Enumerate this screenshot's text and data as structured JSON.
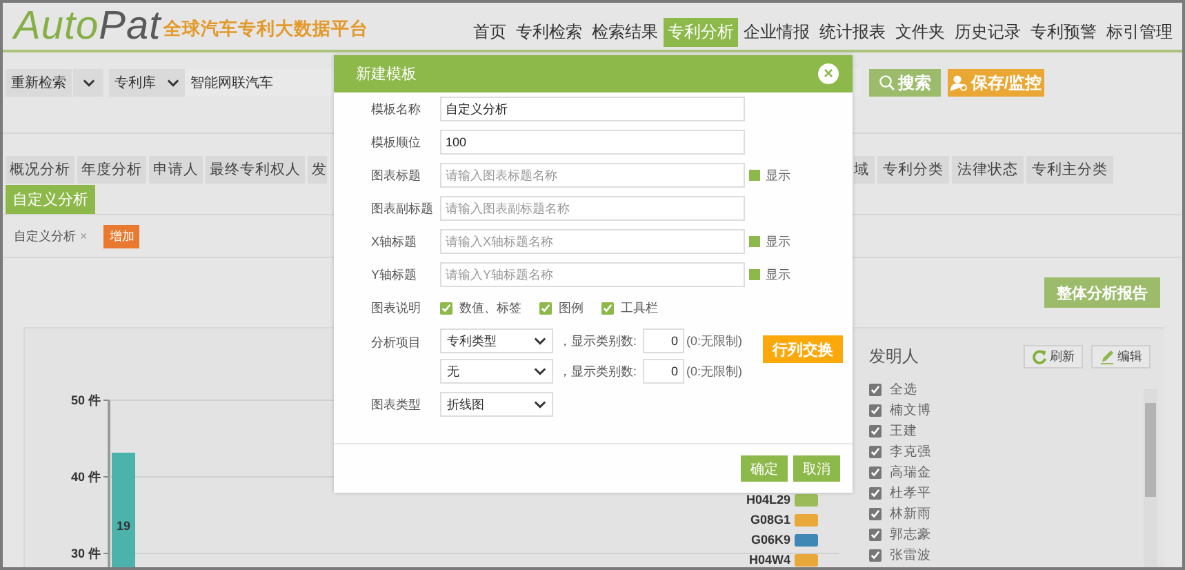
{
  "header": {
    "logo_lead": "Auto",
    "logo_tail": "Pat",
    "tagline": "全球汽车专利大数据平台",
    "nav": [
      {
        "label": "首页",
        "selected": false
      },
      {
        "label": "专利检索",
        "selected": false
      },
      {
        "label": "检索结果",
        "selected": false
      },
      {
        "label": "专利分析",
        "selected": true
      },
      {
        "label": "企业情报",
        "selected": false
      },
      {
        "label": "统计报表",
        "selected": false
      },
      {
        "label": "文件夹",
        "selected": false
      },
      {
        "label": "历史记录",
        "selected": false
      },
      {
        "label": "专利预警",
        "selected": false
      },
      {
        "label": "标引管理",
        "selected": false
      }
    ]
  },
  "search": {
    "mode": "重新检索",
    "database": "专利库",
    "query": "智能网联汽车",
    "search_button": "搜索",
    "save_button": "保存/监控"
  },
  "analysis_tabs_left": [
    {
      "label": "概况分析",
      "selected": false
    },
    {
      "label": "年度分析",
      "selected": false
    },
    {
      "label": "申请人",
      "selected": false
    },
    {
      "label": "最终专利权人",
      "selected": false
    },
    {
      "label": "发",
      "selected": false
    }
  ],
  "analysis_tabs_right": [
    {
      "label": "域",
      "selected": false
    },
    {
      "label": "专利分类",
      "selected": false
    },
    {
      "label": "法律状态",
      "selected": false
    },
    {
      "label": "专利主分类",
      "selected": false
    }
  ],
  "analysis_tabs_row_2": [
    {
      "label": "自定义分析",
      "selected": true
    }
  ],
  "templates": {
    "items": [
      {
        "label": "自定义分析",
        "close": "×"
      }
    ],
    "add_button": "增加"
  },
  "report_button": "整体分析报告",
  "chart": {
    "y_axis_labels": [
      "50 件",
      "40 件",
      "30 件"
    ],
    "bar_label": "19",
    "legend": [
      {
        "label": "H04L29",
        "color": "#9bbb59"
      },
      {
        "label": "G08G1",
        "color": "#e9a93a"
      },
      {
        "label": "G06K9",
        "color": "#3f88b5"
      },
      {
        "label": "H04W4",
        "color": "#e9a93a"
      }
    ]
  },
  "inventors": {
    "title": "发明人",
    "refresh_button": "刷新",
    "edit_button": "编辑",
    "items": [
      {
        "label": "全选",
        "checked": true
      },
      {
        "label": "楠文博",
        "checked": true
      },
      {
        "label": "王建",
        "checked": true
      },
      {
        "label": "李克强",
        "checked": true
      },
      {
        "label": "高瑞金",
        "checked": true
      },
      {
        "label": "杜孝平",
        "checked": true
      },
      {
        "label": "林新雨",
        "checked": true
      },
      {
        "label": "郭志豪",
        "checked": true
      },
      {
        "label": "张雷波",
        "checked": true
      }
    ]
  },
  "dialog": {
    "title": "新建模板",
    "close": "×",
    "fields": [
      {
        "label": "模板名称",
        "value": "自定义分析"
      },
      {
        "label": "模板顺位",
        "value": "100"
      },
      {
        "label": "图表标题",
        "placeholder": "请输入图表标题名称",
        "toggle": {
          "label": "显示",
          "checked": true
        }
      },
      {
        "label": "图表副标题",
        "placeholder": "请输入图表副标题名称"
      },
      {
        "label": "X轴标题",
        "placeholder": "请输入X轴标题名称",
        "toggle": {
          "label": "显示",
          "checked": true
        }
      },
      {
        "label": "Y轴标题",
        "placeholder": "请输入Y轴标题名称",
        "toggle": {
          "label": "显示",
          "checked": true
        }
      }
    ],
    "legend_options": {
      "label": "图表说明",
      "options": [
        {
          "label": "数值、标签",
          "checked": true
        },
        {
          "label": "图例",
          "checked": true
        },
        {
          "label": "工具栏",
          "checked": true
        }
      ]
    },
    "analysis_items": {
      "label": "分析项目",
      "rows": [
        {
          "select": "专利类型",
          "count_label": "，显示类别数:",
          "count": "0",
          "hint": "(0:无限制)"
        },
        {
          "select": "无",
          "count_label": "，显示类别数:",
          "count": "0",
          "hint": "(0:无限制)"
        }
      ],
      "swap_button": "行列交换"
    },
    "chart_type": {
      "label": "图表类型",
      "select": "折线图"
    },
    "buttons": [
      "确定",
      "取消"
    ]
  }
}
